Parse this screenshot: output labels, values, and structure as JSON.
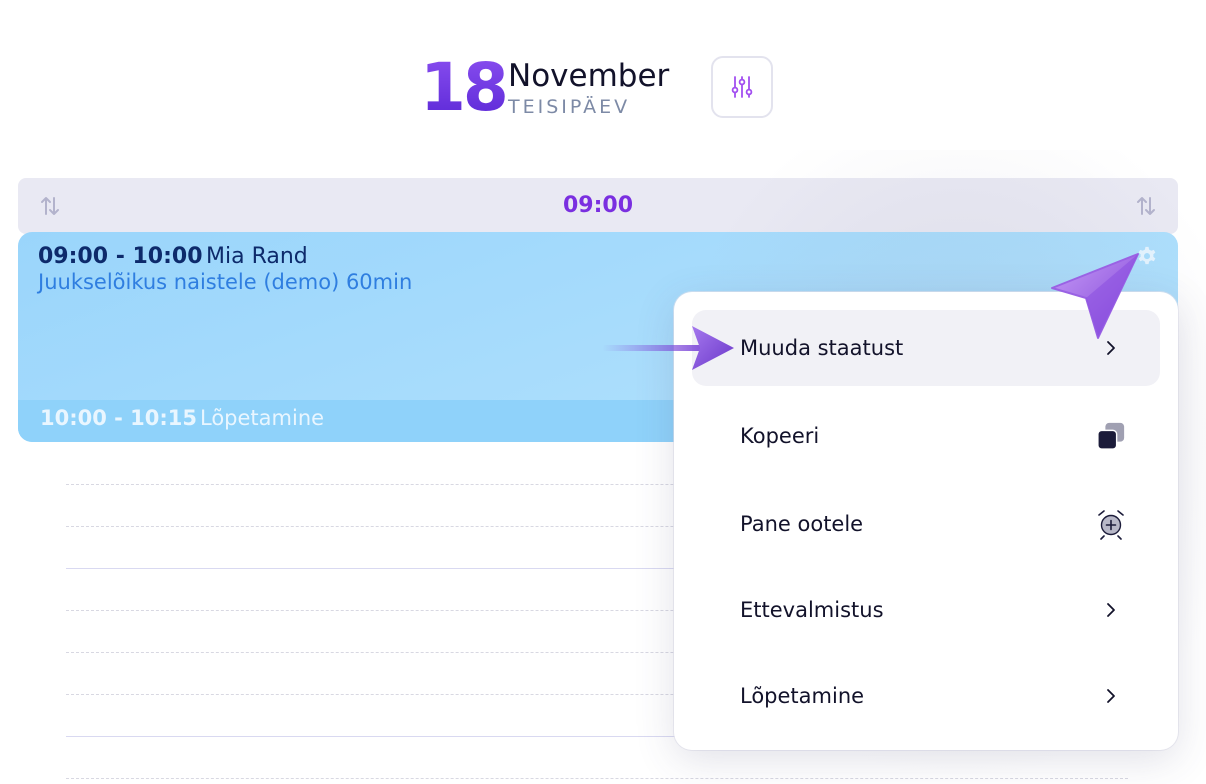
{
  "header": {
    "day_number": "18",
    "month": "November",
    "weekday": "TEISIPÄEV",
    "filter_icon": "sliders-icon"
  },
  "time_bar": {
    "label": "09:00",
    "sort_icon": "sort-arrows-icon"
  },
  "appointment": {
    "time": "09:00 - 10:00",
    "client": "Mia Rand",
    "service": "Juukselõikus naistele (demo) 60min",
    "settings_icon": "gear-icon",
    "follow_up": {
      "time": "10:00 - 10:15",
      "label": "Lõpetamine"
    }
  },
  "context_menu": {
    "items": [
      {
        "label": "Muuda staatust",
        "icon": "chevron-right-icon",
        "highlighted": true
      },
      {
        "label": "Kopeeri",
        "icon": "copy-icon"
      },
      {
        "label": "Pane ootele",
        "icon": "alarm-add-icon"
      },
      {
        "label": "Ettevalmistus",
        "icon": "chevron-right-icon"
      },
      {
        "label": "Lõpetamine",
        "icon": "chevron-right-icon"
      }
    ]
  },
  "colors": {
    "accent": "#7a2fe0",
    "appointment_bg": "#a8ddfc",
    "client_text": "#0d2a6b",
    "service_text": "#2f7ee0"
  }
}
